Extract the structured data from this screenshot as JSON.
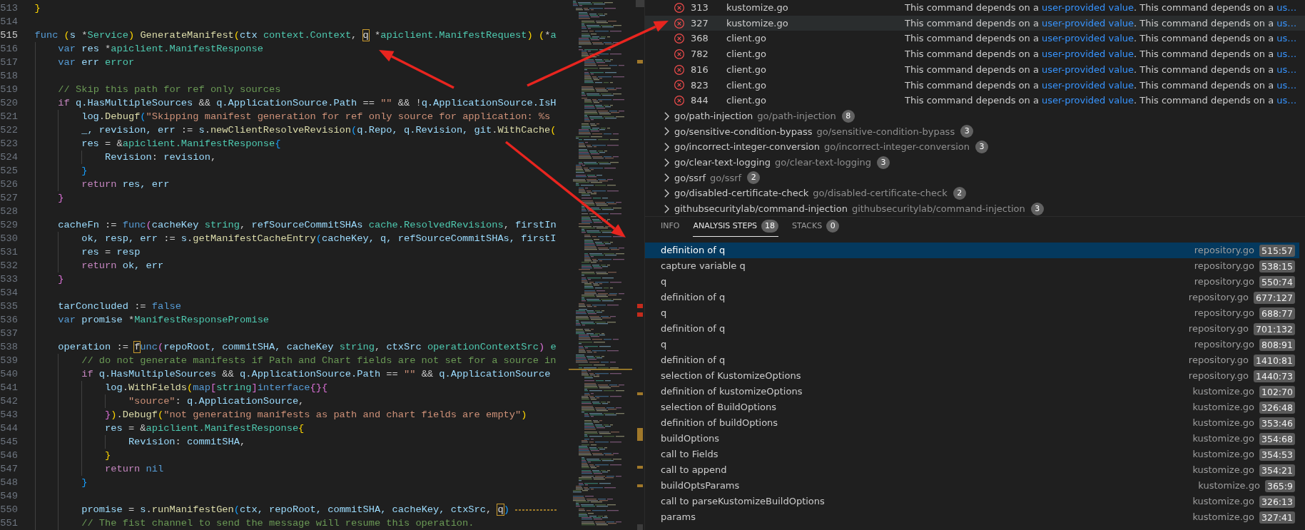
{
  "editor": {
    "lines": [
      {
        "number": "513",
        "current": false,
        "trailing_dash": false,
        "tokens": [
          {
            "kind": "bracket-level1",
            "text": "}"
          }
        ]
      },
      {
        "number": "514",
        "current": false,
        "trailing_dash": false
      },
      {
        "number": "515",
        "current": true,
        "trailing_dash": false,
        "tokens": [
          {
            "kind": "keyword",
            "text": "func "
          },
          {
            "kind": "bracket-level1",
            "text": "("
          },
          {
            "kind": "variable",
            "text": "s"
          },
          {
            "kind": "plain",
            "text": " *"
          },
          {
            "kind": "type",
            "text": "Service"
          },
          {
            "kind": "bracket-level1",
            "text": ") "
          },
          {
            "kind": "function",
            "text": "GenerateManifest"
          },
          {
            "kind": "bracket-level1",
            "text": "("
          },
          {
            "kind": "variable",
            "text": "ctx "
          },
          {
            "kind": "type",
            "text": "context.Context"
          },
          {
            "kind": "plain",
            "text": ", "
          },
          {
            "kind": "match",
            "text": "q"
          },
          {
            "kind": "plain",
            "text": " *"
          },
          {
            "kind": "type",
            "text": "apiclient.ManifestRequest"
          },
          {
            "kind": "bracket-level1",
            "text": ") ("
          },
          {
            "kind": "plain",
            "text": "*"
          },
          {
            "kind": "type",
            "text": "a"
          }
        ]
      },
      {
        "number": "516",
        "current": false,
        "trailing_dash": false,
        "tokens": [
          {
            "kind": "keyword",
            "text": "\tvar "
          },
          {
            "kind": "variable",
            "text": "res"
          },
          {
            "kind": "plain",
            "text": " *"
          },
          {
            "kind": "type",
            "text": "apiclient.ManifestResponse"
          }
        ]
      },
      {
        "number": "517",
        "current": false,
        "trailing_dash": false,
        "tokens": [
          {
            "kind": "keyword",
            "text": "\tvar "
          },
          {
            "kind": "variable",
            "text": "err "
          },
          {
            "kind": "type",
            "text": "error"
          }
        ]
      },
      {
        "number": "518",
        "current": false,
        "trailing_dash": false
      },
      {
        "number": "519",
        "current": false,
        "trailing_dash": false,
        "tokens": [
          {
            "kind": "comment",
            "text": "\t// Skip this path for ref only sources"
          }
        ]
      },
      {
        "number": "520",
        "current": false,
        "trailing_dash": false,
        "tokens": [
          {
            "kind": "control",
            "text": "\tif "
          },
          {
            "kind": "variable",
            "text": "q.HasMultipleSources"
          },
          {
            "kind": "plain",
            "text": " && "
          },
          {
            "kind": "variable",
            "text": "q.ApplicationSource.Path"
          },
          {
            "kind": "plain",
            "text": " == "
          },
          {
            "kind": "string",
            "text": "\"\""
          },
          {
            "kind": "plain",
            "text": " && !"
          },
          {
            "kind": "variable",
            "text": "q.ApplicationSource.IsH"
          }
        ]
      },
      {
        "number": "521",
        "current": false,
        "trailing_dash": false,
        "tokens": [
          {
            "kind": "variable",
            "text": "\t\tlog"
          },
          {
            "kind": "plain",
            "text": "."
          },
          {
            "kind": "function",
            "text": "Debugf"
          },
          {
            "kind": "bracket-level3",
            "text": "("
          },
          {
            "kind": "string",
            "text": "\"Skipping manifest generation for ref only source for application: %s"
          }
        ]
      },
      {
        "number": "522",
        "current": false,
        "trailing_dash": false,
        "tokens": [
          {
            "kind": "variable",
            "text": "\t\t_, revision, err"
          },
          {
            "kind": "plain",
            "text": " := "
          },
          {
            "kind": "variable",
            "text": "s"
          },
          {
            "kind": "plain",
            "text": "."
          },
          {
            "kind": "function",
            "text": "newClientResolveRevision"
          },
          {
            "kind": "bracket-level3",
            "text": "("
          },
          {
            "kind": "variable",
            "text": "q.Repo, q.Revision, git"
          },
          {
            "kind": "plain",
            "text": "."
          },
          {
            "kind": "function",
            "text": "WithCache"
          },
          {
            "kind": "bracket-level1",
            "text": "("
          }
        ]
      },
      {
        "number": "523",
        "current": false,
        "trailing_dash": false,
        "tokens": [
          {
            "kind": "variable",
            "text": "\t\tres"
          },
          {
            "kind": "plain",
            "text": " = &"
          },
          {
            "kind": "type",
            "text": "apiclient.ManifestResponse"
          },
          {
            "kind": "bracket-level3",
            "text": "{"
          }
        ]
      },
      {
        "number": "524",
        "current": false,
        "trailing_dash": false,
        "tokens": [
          {
            "kind": "variable",
            "text": "\t\t\tRevision"
          },
          {
            "kind": "plain",
            "text": ": "
          },
          {
            "kind": "variable",
            "text": "revision"
          },
          {
            "kind": "plain",
            "text": ","
          }
        ]
      },
      {
        "number": "525",
        "current": false,
        "trailing_dash": false,
        "tokens": [
          {
            "kind": "bracket-level3",
            "text": "\t\t}"
          }
        ]
      },
      {
        "number": "526",
        "current": false,
        "trailing_dash": false,
        "tokens": [
          {
            "kind": "control",
            "text": "\t\treturn "
          },
          {
            "kind": "variable",
            "text": "res, err"
          }
        ]
      },
      {
        "number": "527",
        "current": false,
        "trailing_dash": false,
        "tokens": [
          {
            "kind": "bracket-level2",
            "text": "\t}"
          }
        ]
      },
      {
        "number": "528",
        "current": false,
        "trailing_dash": false
      },
      {
        "number": "529",
        "current": false,
        "trailing_dash": false,
        "tokens": [
          {
            "kind": "variable",
            "text": "\tcacheFn"
          },
          {
            "kind": "plain",
            "text": " := "
          },
          {
            "kind": "keyword",
            "text": "func"
          },
          {
            "kind": "bracket-level2",
            "text": "("
          },
          {
            "kind": "variable",
            "text": "cacheKey "
          },
          {
            "kind": "type",
            "text": "string"
          },
          {
            "kind": "plain",
            "text": ", "
          },
          {
            "kind": "variable",
            "text": "refSourceCommitSHAs "
          },
          {
            "kind": "type",
            "text": "cache.ResolvedRevisions"
          },
          {
            "kind": "plain",
            "text": ", "
          },
          {
            "kind": "variable",
            "text": "firstIn"
          }
        ]
      },
      {
        "number": "530",
        "current": false,
        "trailing_dash": false,
        "tokens": [
          {
            "kind": "variable",
            "text": "\t\tok, resp, err"
          },
          {
            "kind": "plain",
            "text": " := "
          },
          {
            "kind": "variable",
            "text": "s"
          },
          {
            "kind": "plain",
            "text": "."
          },
          {
            "kind": "function",
            "text": "getManifestCacheEntry"
          },
          {
            "kind": "bracket-level3",
            "text": "("
          },
          {
            "kind": "variable",
            "text": "cacheKey, q, refSourceCommitSHAs, firstI"
          }
        ]
      },
      {
        "number": "531",
        "current": false,
        "trailing_dash": false,
        "tokens": [
          {
            "kind": "variable",
            "text": "\t\tres"
          },
          {
            "kind": "plain",
            "text": " = "
          },
          {
            "kind": "variable",
            "text": "resp"
          }
        ]
      },
      {
        "number": "532",
        "current": false,
        "trailing_dash": false,
        "tokens": [
          {
            "kind": "control",
            "text": "\t\treturn "
          },
          {
            "kind": "variable",
            "text": "ok, err"
          }
        ]
      },
      {
        "number": "533",
        "current": false,
        "trailing_dash": false,
        "tokens": [
          {
            "kind": "bracket-level2",
            "text": "\t}"
          }
        ]
      },
      {
        "number": "534",
        "current": false,
        "trailing_dash": false
      },
      {
        "number": "535",
        "current": false,
        "trailing_dash": false,
        "tokens": [
          {
            "kind": "variable",
            "text": "\ttarConcluded"
          },
          {
            "kind": "plain",
            "text": " := "
          },
          {
            "kind": "keyword",
            "text": "false"
          }
        ]
      },
      {
        "number": "536",
        "current": false,
        "trailing_dash": false,
        "tokens": [
          {
            "kind": "keyword",
            "text": "\tvar "
          },
          {
            "kind": "variable",
            "text": "promise"
          },
          {
            "kind": "plain",
            "text": " *"
          },
          {
            "kind": "type",
            "text": "ManifestResponsePromise"
          }
        ]
      },
      {
        "number": "537",
        "current": false,
        "trailing_dash": false
      },
      {
        "number": "538",
        "current": false,
        "trailing_dash": false,
        "tokens": [
          {
            "kind": "variable",
            "text": "\toperation"
          },
          {
            "kind": "plain",
            "text": " := "
          },
          {
            "kind": "match",
            "text": "f"
          },
          {
            "kind": "keyword",
            "text": "unc"
          },
          {
            "kind": "bracket-level2",
            "text": "("
          },
          {
            "kind": "variable",
            "text": "repoRoot, commitSHA, cacheKey "
          },
          {
            "kind": "type",
            "text": "string"
          },
          {
            "kind": "plain",
            "text": ", "
          },
          {
            "kind": "variable",
            "text": "ctxSrc "
          },
          {
            "kind": "type",
            "text": "operationContextSrc"
          },
          {
            "kind": "bracket-level2",
            "text": ") "
          },
          {
            "kind": "type",
            "text": "e"
          }
        ]
      },
      {
        "number": "539",
        "current": false,
        "trailing_dash": false,
        "tokens": [
          {
            "kind": "comment",
            "text": "\t\t// do not generate manifests if Path and Chart fields are not set for a source in"
          }
        ]
      },
      {
        "number": "540",
        "current": false,
        "trailing_dash": false,
        "tokens": [
          {
            "kind": "control",
            "text": "\t\tif "
          },
          {
            "kind": "variable",
            "text": "q.HasMultipleSources"
          },
          {
            "kind": "plain",
            "text": " && "
          },
          {
            "kind": "variable",
            "text": "q.ApplicationSource.Path"
          },
          {
            "kind": "plain",
            "text": " == "
          },
          {
            "kind": "string",
            "text": "\"\""
          },
          {
            "kind": "plain",
            "text": " && "
          },
          {
            "kind": "variable",
            "text": "q.ApplicationSource"
          }
        ]
      },
      {
        "number": "541",
        "current": false,
        "trailing_dash": false,
        "tokens": [
          {
            "kind": "variable",
            "text": "\t\t\tlog"
          },
          {
            "kind": "plain",
            "text": "."
          },
          {
            "kind": "function",
            "text": "WithFields"
          },
          {
            "kind": "bracket-level1",
            "text": "("
          },
          {
            "kind": "keyword",
            "text": "map"
          },
          {
            "kind": "bracket-level2",
            "text": "["
          },
          {
            "kind": "type",
            "text": "string"
          },
          {
            "kind": "bracket-level2",
            "text": "]"
          },
          {
            "kind": "keyword",
            "text": "interface"
          },
          {
            "kind": "bracket-level2",
            "text": "{}{"
          }
        ]
      },
      {
        "number": "542",
        "current": false,
        "trailing_dash": false,
        "tokens": [
          {
            "kind": "string",
            "text": "\t\t\t\t\"source\""
          },
          {
            "kind": "plain",
            "text": ": "
          },
          {
            "kind": "variable",
            "text": "q.ApplicationSource"
          },
          {
            "kind": "plain",
            "text": ","
          }
        ]
      },
      {
        "number": "543",
        "current": false,
        "trailing_dash": false,
        "tokens": [
          {
            "kind": "bracket-level2",
            "text": "\t\t\t}"
          },
          {
            "kind": "bracket-level1",
            "text": ")"
          },
          {
            "kind": "plain",
            "text": "."
          },
          {
            "kind": "function",
            "text": "Debugf"
          },
          {
            "kind": "bracket-level1",
            "text": "("
          },
          {
            "kind": "string",
            "text": "\"not generating manifests as path and chart fields are empty\""
          },
          {
            "kind": "bracket-level1",
            "text": ")"
          }
        ]
      },
      {
        "number": "544",
        "current": false,
        "trailing_dash": false,
        "tokens": [
          {
            "kind": "variable",
            "text": "\t\t\tres"
          },
          {
            "kind": "plain",
            "text": " = &"
          },
          {
            "kind": "type",
            "text": "apiclient.ManifestResponse"
          },
          {
            "kind": "bracket-level1",
            "text": "{"
          }
        ]
      },
      {
        "number": "545",
        "current": false,
        "trailing_dash": false,
        "tokens": [
          {
            "kind": "variable",
            "text": "\t\t\t\tRevision"
          },
          {
            "kind": "plain",
            "text": ": "
          },
          {
            "kind": "variable",
            "text": "commitSHA"
          },
          {
            "kind": "plain",
            "text": ","
          }
        ]
      },
      {
        "number": "546",
        "current": false,
        "trailing_dash": false,
        "tokens": [
          {
            "kind": "bracket-level1",
            "text": "\t\t\t}"
          }
        ]
      },
      {
        "number": "547",
        "current": false,
        "trailing_dash": false,
        "tokens": [
          {
            "kind": "control",
            "text": "\t\t\treturn "
          },
          {
            "kind": "keyword",
            "text": "nil"
          }
        ]
      },
      {
        "number": "548",
        "current": false,
        "trailing_dash": false,
        "tokens": [
          {
            "kind": "bracket-level3",
            "text": "\t\t}"
          }
        ]
      },
      {
        "number": "549",
        "current": false,
        "trailing_dash": false
      },
      {
        "number": "550",
        "current": false,
        "trailing_dash": true,
        "tokens": [
          {
            "kind": "variable",
            "text": "\t\tpromise"
          },
          {
            "kind": "plain",
            "text": " = "
          },
          {
            "kind": "variable",
            "text": "s"
          },
          {
            "kind": "plain",
            "text": "."
          },
          {
            "kind": "function",
            "text": "runManifestGen"
          },
          {
            "kind": "bracket-level3",
            "text": "("
          },
          {
            "kind": "variable",
            "text": "ctx, repoRoot, commitSHA, cacheKey, ctxSrc"
          },
          {
            "kind": "plain",
            "text": ", "
          },
          {
            "kind": "match",
            "text": "q"
          },
          {
            "kind": "bracket-level3",
            "text": ")"
          }
        ]
      },
      {
        "number": "551",
        "current": false,
        "trailing_dash": false,
        "tokens": [
          {
            "kind": "comment",
            "text": "\t\t// The fist channel to send the message will resume this operation."
          }
        ]
      }
    ]
  },
  "results": [
    {
      "line": "313",
      "file": "kustomize.go",
      "selected": false,
      "message": [
        {
          "kind": "text",
          "text": "This command depends on a "
        },
        {
          "kind": "link",
          "text": "user-provided value"
        },
        {
          "kind": "text",
          "text": ". This command depends on a "
        },
        {
          "kind": "link",
          "text": "us…"
        }
      ]
    },
    {
      "line": "327",
      "file": "kustomize.go",
      "selected": true,
      "message": [
        {
          "kind": "text",
          "text": "This command depends on a "
        },
        {
          "kind": "link",
          "text": "user-provided value"
        },
        {
          "kind": "text",
          "text": ". This command depends on a "
        },
        {
          "kind": "link",
          "text": "us…"
        }
      ]
    },
    {
      "line": "368",
      "file": "client.go",
      "selected": false,
      "message": [
        {
          "kind": "text",
          "text": "This command depends on a "
        },
        {
          "kind": "link",
          "text": "user-provided value"
        },
        {
          "kind": "text",
          "text": ". This command depends on a "
        },
        {
          "kind": "link",
          "text": "us…"
        }
      ]
    },
    {
      "line": "782",
      "file": "client.go",
      "selected": false,
      "message": [
        {
          "kind": "text",
          "text": "This command depends on a "
        },
        {
          "kind": "link",
          "text": "user-provided value"
        },
        {
          "kind": "text",
          "text": ". This command depends on a "
        },
        {
          "kind": "link",
          "text": "us…"
        }
      ]
    },
    {
      "line": "816",
      "file": "client.go",
      "selected": false,
      "message": [
        {
          "kind": "text",
          "text": "This command depends on a "
        },
        {
          "kind": "link",
          "text": "user-provided value"
        },
        {
          "kind": "text",
          "text": ". This command depends on a "
        },
        {
          "kind": "link",
          "text": "us…"
        }
      ]
    },
    {
      "line": "823",
      "file": "client.go",
      "selected": false,
      "message": [
        {
          "kind": "text",
          "text": "This command depends on a "
        },
        {
          "kind": "link",
          "text": "user-provided value"
        },
        {
          "kind": "text",
          "text": ". This command depends on a "
        },
        {
          "kind": "link",
          "text": "us…"
        }
      ]
    },
    {
      "line": "844",
      "file": "client.go",
      "selected": false,
      "message": [
        {
          "kind": "text",
          "text": "This command depends on a "
        },
        {
          "kind": "link",
          "text": "user-provided value"
        },
        {
          "kind": "text",
          "text": ". This command depends on a "
        },
        {
          "kind": "link",
          "text": "us…"
        }
      ]
    }
  ],
  "rule_groups": [
    {
      "rule": "go/path-injection",
      "description": "go/path-injection",
      "count": "8",
      "expanded": false
    },
    {
      "rule": "go/sensitive-condition-bypass",
      "description": "go/sensitive-condition-bypass",
      "count": "3",
      "expanded": false
    },
    {
      "rule": "go/incorrect-integer-conversion",
      "description": "go/incorrect-integer-conversion",
      "count": "3",
      "expanded": false
    },
    {
      "rule": "go/clear-text-logging",
      "description": "go/clear-text-logging",
      "count": "3",
      "expanded": false
    },
    {
      "rule": "go/ssrf",
      "description": "go/ssrf",
      "count": "2",
      "expanded": false
    },
    {
      "rule": "go/disabled-certificate-check",
      "description": "go/disabled-certificate-check",
      "count": "2",
      "expanded": false
    },
    {
      "rule": "githubsecuritylab/command-injection",
      "description": "githubsecuritylab/command-injection",
      "count": "3",
      "expanded": false
    }
  ],
  "details": {
    "tabs": [
      {
        "label": "INFO",
        "selected": false
      },
      {
        "label": "ANALYSIS STEPS",
        "count": "18",
        "selected": true
      },
      {
        "label": "STACKS",
        "count": "0",
        "selected": false
      }
    ],
    "steps": [
      {
        "label": "definition of q",
        "file": "repository.go",
        "location": "515:57",
        "selected": true
      },
      {
        "label": "capture variable q",
        "file": "repository.go",
        "location": "538:15",
        "selected": false
      },
      {
        "label": "q",
        "file": "repository.go",
        "location": "550:74",
        "selected": false
      },
      {
        "label": "definition of q",
        "file": "repository.go",
        "location": "677:127",
        "selected": false
      },
      {
        "label": "q",
        "file": "repository.go",
        "location": "688:77",
        "selected": false
      },
      {
        "label": "definition of q",
        "file": "repository.go",
        "location": "701:132",
        "selected": false
      },
      {
        "label": "q",
        "file": "repository.go",
        "location": "808:91",
        "selected": false
      },
      {
        "label": "definition of q",
        "file": "repository.go",
        "location": "1410:81",
        "selected": false
      },
      {
        "label": "selection of KustomizeOptions",
        "file": "repository.go",
        "location": "1440:73",
        "selected": false
      },
      {
        "label": "definition of kustomizeOptions",
        "file": "kustomize.go",
        "location": "102:70",
        "selected": false
      },
      {
        "label": "selection of BuildOptions",
        "file": "kustomize.go",
        "location": "326:48",
        "selected": false
      },
      {
        "label": "definition of buildOptions",
        "file": "kustomize.go",
        "location": "353:46",
        "selected": false
      },
      {
        "label": "buildOptions",
        "file": "kustomize.go",
        "location": "354:68",
        "selected": false
      },
      {
        "label": "call to Fields",
        "file": "kustomize.go",
        "location": "354:53",
        "selected": false
      },
      {
        "label": "call to append",
        "file": "kustomize.go",
        "location": "354:21",
        "selected": false
      },
      {
        "label": "buildOptsParams",
        "file": "kustomize.go",
        "location": "365:9",
        "selected": false
      },
      {
        "label": "call to parseKustomizeBuildOptions",
        "file": "kustomize.go",
        "location": "326:13",
        "selected": false
      },
      {
        "label": "params",
        "file": "kustomize.go",
        "location": "327:41",
        "selected": false
      }
    ]
  }
}
